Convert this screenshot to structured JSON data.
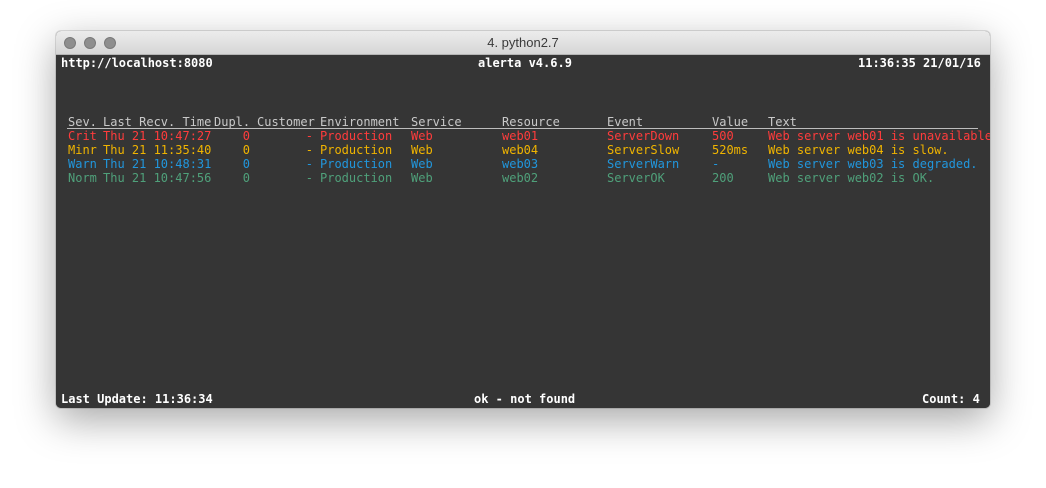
{
  "window": {
    "title": "4. python2.7"
  },
  "header": {
    "endpoint": "http://localhost:8080",
    "app": "alerta v4.6.9",
    "clock": "11:36:35 21/01/16"
  },
  "columns": [
    "Sev.",
    "Last Recv. Time",
    "Dupl.",
    "Customer",
    "Environment",
    "Service",
    "Resource",
    "Event",
    "Value",
    "Text"
  ],
  "alerts": [
    {
      "sev": "Crit",
      "time": "Thu 21 10:47:27",
      "dupl": "0",
      "customer": "-",
      "environment": "Production",
      "service": "Web",
      "resource": "web01",
      "event": "ServerDown",
      "value": "500",
      "text": "Web server web01 is unavailable"
    },
    {
      "sev": "Minr",
      "time": "Thu 21 11:35:40",
      "dupl": "0",
      "customer": "-",
      "environment": "Production",
      "service": "Web",
      "resource": "web04",
      "event": "ServerSlow",
      "value": "520ms",
      "text": "Web server web04 is slow."
    },
    {
      "sev": "Warn",
      "time": "Thu 21 10:48:31",
      "dupl": "0",
      "customer": "-",
      "environment": "Production",
      "service": "Web",
      "resource": "web03",
      "event": "ServerWarn",
      "value": "-",
      "text": "Web server web03 is degraded."
    },
    {
      "sev": "Norm",
      "time": "Thu 21 10:47:56",
      "dupl": "0",
      "customer": "-",
      "environment": "Production",
      "service": "Web",
      "resource": "web02",
      "event": "ServerOK",
      "value": "200",
      "text": "Web server web02 is OK."
    }
  ],
  "severity_colors": {
    "Crit": "#ff3c3c",
    "Minr": "#f0b400",
    "Warn": "#2196dc",
    "Norm": "#4fa07a"
  },
  "footer": {
    "last_update": "Last Update: 11:36:34",
    "status": "ok - not found",
    "count": "Count: 4"
  }
}
